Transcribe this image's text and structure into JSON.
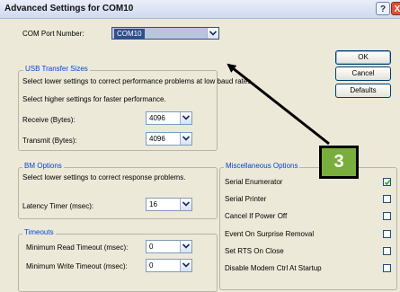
{
  "window": {
    "title": "Advanced Settings for COM10",
    "help_label": "?",
    "close_label": "X"
  },
  "com_port": {
    "label": "COM Port Number:",
    "value": "COM10"
  },
  "usb": {
    "legend": "USB Transfer Sizes",
    "note1": "Select lower settings to correct performance problems at low baud rates.",
    "note2": "Select higher settings for faster performance.",
    "receive_label": "Receive (Bytes):",
    "receive_value": "4096",
    "transmit_label": "Transmit (Bytes):",
    "transmit_value": "4096"
  },
  "bm": {
    "legend": "BM Options",
    "note": "Select lower settings to correct response problems.",
    "latency_label": "Latency Timer (msec):",
    "latency_value": "16"
  },
  "timeouts": {
    "legend": "Timeouts",
    "read_label": "Minimum Read Timeout (msec):",
    "read_value": "0",
    "write_label": "Minimum Write Timeout (msec):",
    "write_value": "0"
  },
  "misc": {
    "legend": "Miscellaneous Options",
    "items": [
      {
        "label": "Serial Enumerator",
        "checked": true
      },
      {
        "label": "Serial Printer",
        "checked": false
      },
      {
        "label": "Cancel If Power Off",
        "checked": false
      },
      {
        "label": "Event On Surprise Removal",
        "checked": false
      },
      {
        "label": "Set RTS On Close",
        "checked": false
      },
      {
        "label": "Disable Modem Ctrl At Startup",
        "checked": false
      }
    ]
  },
  "buttons": {
    "ok": "OK",
    "cancel": "Cancel",
    "defaults": "Defaults"
  },
  "annotation": {
    "number": "3",
    "color": "#7aae3c"
  }
}
